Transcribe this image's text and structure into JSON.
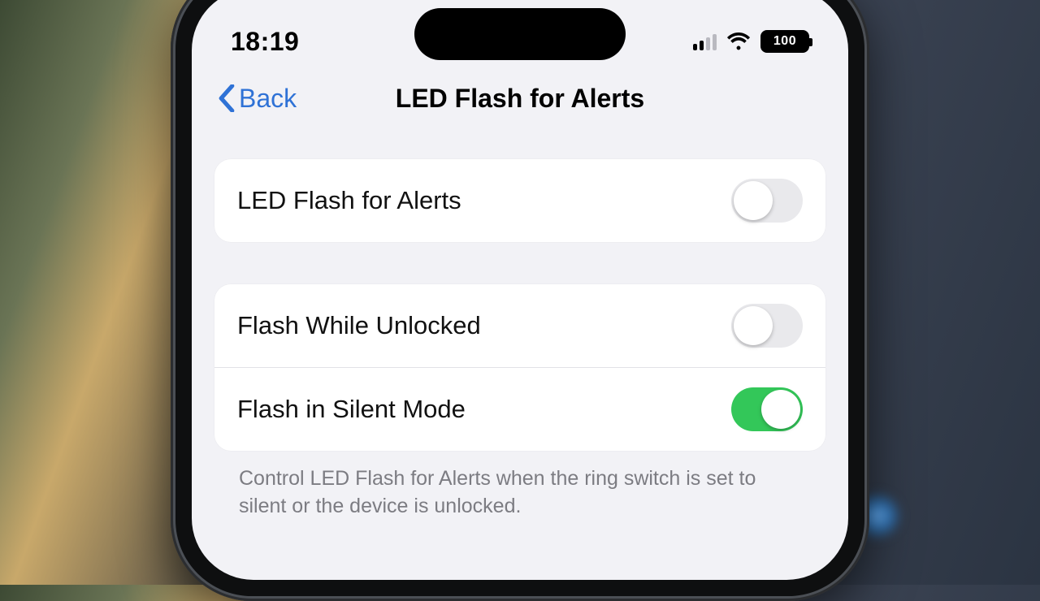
{
  "status": {
    "time": "18:19",
    "battery_level": "100"
  },
  "nav": {
    "back_label": "Back",
    "title": "LED Flash for Alerts"
  },
  "group1": {
    "rows": [
      {
        "label": "LED Flash for Alerts",
        "on": false
      }
    ]
  },
  "group2": {
    "rows": [
      {
        "label": "Flash While Unlocked",
        "on": false
      },
      {
        "label": "Flash in Silent Mode",
        "on": true
      }
    ]
  },
  "footer": "Control LED Flash for Alerts when the ring switch is set to silent or the device is unlocked."
}
